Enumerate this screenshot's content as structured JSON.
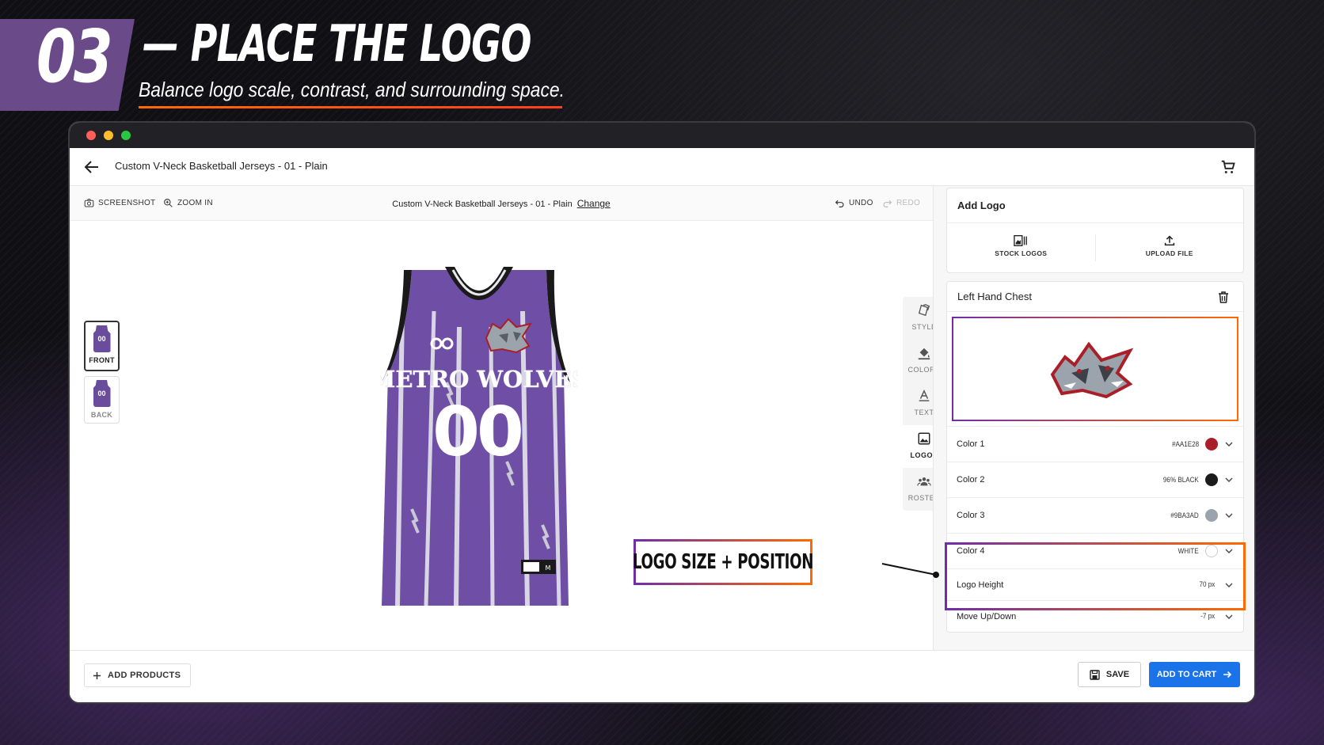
{
  "header": {
    "step_number": "03",
    "headline": "— PLACE THE LOGO",
    "subline": "Balance logo scale, contrast, and surrounding space."
  },
  "app": {
    "title": "Custom V-Neck Basketball Jerseys - 01 - Plain"
  },
  "toolbar": {
    "screenshot": "SCREENSHOT",
    "zoom_in": "ZOOM IN",
    "product_name": "Custom V-Neck Basketball Jerseys - 01 - Plain",
    "change": "Change",
    "undo": "UNDO",
    "redo": "REDO"
  },
  "views": [
    {
      "label": "FRONT",
      "mini": "00"
    },
    {
      "label": "BACK",
      "mini": "00"
    }
  ],
  "jersey": {
    "team_name": "METRO WOLVES",
    "number": "00",
    "tag_size": "M",
    "primary_color": "#6f4ea6",
    "trim_color": "#1a1a1a"
  },
  "side_rail": [
    {
      "label": "STYLE",
      "icon": "style-icon"
    },
    {
      "label": "COLORS",
      "icon": "paint-bucket-icon"
    },
    {
      "label": "TEXT",
      "icon": "text-icon"
    },
    {
      "label": "LOGOS",
      "icon": "image-icon"
    },
    {
      "label": "ROSTER",
      "icon": "people-icon"
    }
  ],
  "callout": {
    "text": "LOGO SIZE + POSITION"
  },
  "panel": {
    "add_logo": {
      "title": "Add Logo",
      "stock_logos": "STOCK LOGOS",
      "upload_file": "UPLOAD FILE"
    },
    "placement": {
      "title": "Left Hand Chest",
      "colors": [
        {
          "label": "Color 1",
          "value": "#AA1E28",
          "swatch": "#aa1e28"
        },
        {
          "label": "Color 2",
          "value": "96% BLACK",
          "swatch": "#1b1b1b"
        },
        {
          "label": "Color 3",
          "value": "#9BA3AD",
          "swatch": "#9ba3ad"
        },
        {
          "label": "Color 4",
          "value": "WHITE",
          "swatch": "#ffffff"
        }
      ],
      "logo_height": {
        "label": "Logo Height",
        "value": "70 px"
      },
      "move": {
        "label": "Move Up/Down",
        "value": "-7 px"
      }
    }
  },
  "bottom": {
    "add_products": "ADD PRODUCTS",
    "save": "SAVE",
    "add_to_cart": "ADD TO CART"
  },
  "colors": {
    "accent_purple": "#6f2da8",
    "accent_orange": "#ff6a00",
    "primary_blue": "#1a73e8"
  }
}
